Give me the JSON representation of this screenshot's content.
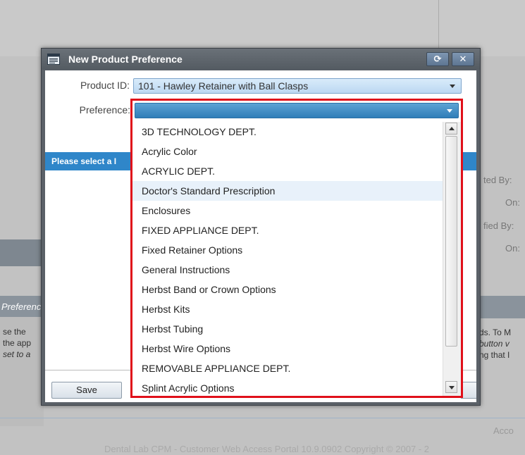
{
  "background": {
    "left_panel_title": "Preferenc",
    "left_lines": [
      "se the",
      "the app",
      "set to a"
    ],
    "right_labels": [
      "ted By:",
      "On:",
      "fied By:",
      "On:"
    ],
    "right_lines": [
      "ds. To M",
      "button v",
      "ng that I"
    ],
    "footer_account": "Acco",
    "footer_copyright": "Dental Lab CPM - Customer Web Access Portal 10.9.0902    Copyright © 2007 - 2"
  },
  "dialog": {
    "title": "New Product Preference",
    "refresh_button": "⟳",
    "close_button": "✕",
    "product_id_label": "Product ID:",
    "product_id_value": "101 - Hawley Retainer with Ball Clasps",
    "preference_label": "Preference:",
    "preference_value": "",
    "info_bar": "Please select a I",
    "save_button": "Save"
  },
  "dropdown": {
    "options": [
      "3D TECHNOLOGY DEPT.",
      "Acrylic Color",
      "ACRYLIC DEPT.",
      "Doctor's Standard Prescription",
      "Enclosures",
      "FIXED APPLIANCE DEPT.",
      "Fixed Retainer Options",
      "General Instructions",
      "Herbst Band or Crown Options",
      "Herbst Kits",
      "Herbst Tubing",
      "Herbst Wire Options",
      "REMOVABLE APPLIANCE DEPT.",
      "Splint Acrylic Options"
    ],
    "hovered_option": "Doctor's Standard Prescription"
  },
  "colors": {
    "highlight_border": "#e0101a",
    "info_bar": "#2f86c9",
    "title_bar": "#5b6168"
  }
}
